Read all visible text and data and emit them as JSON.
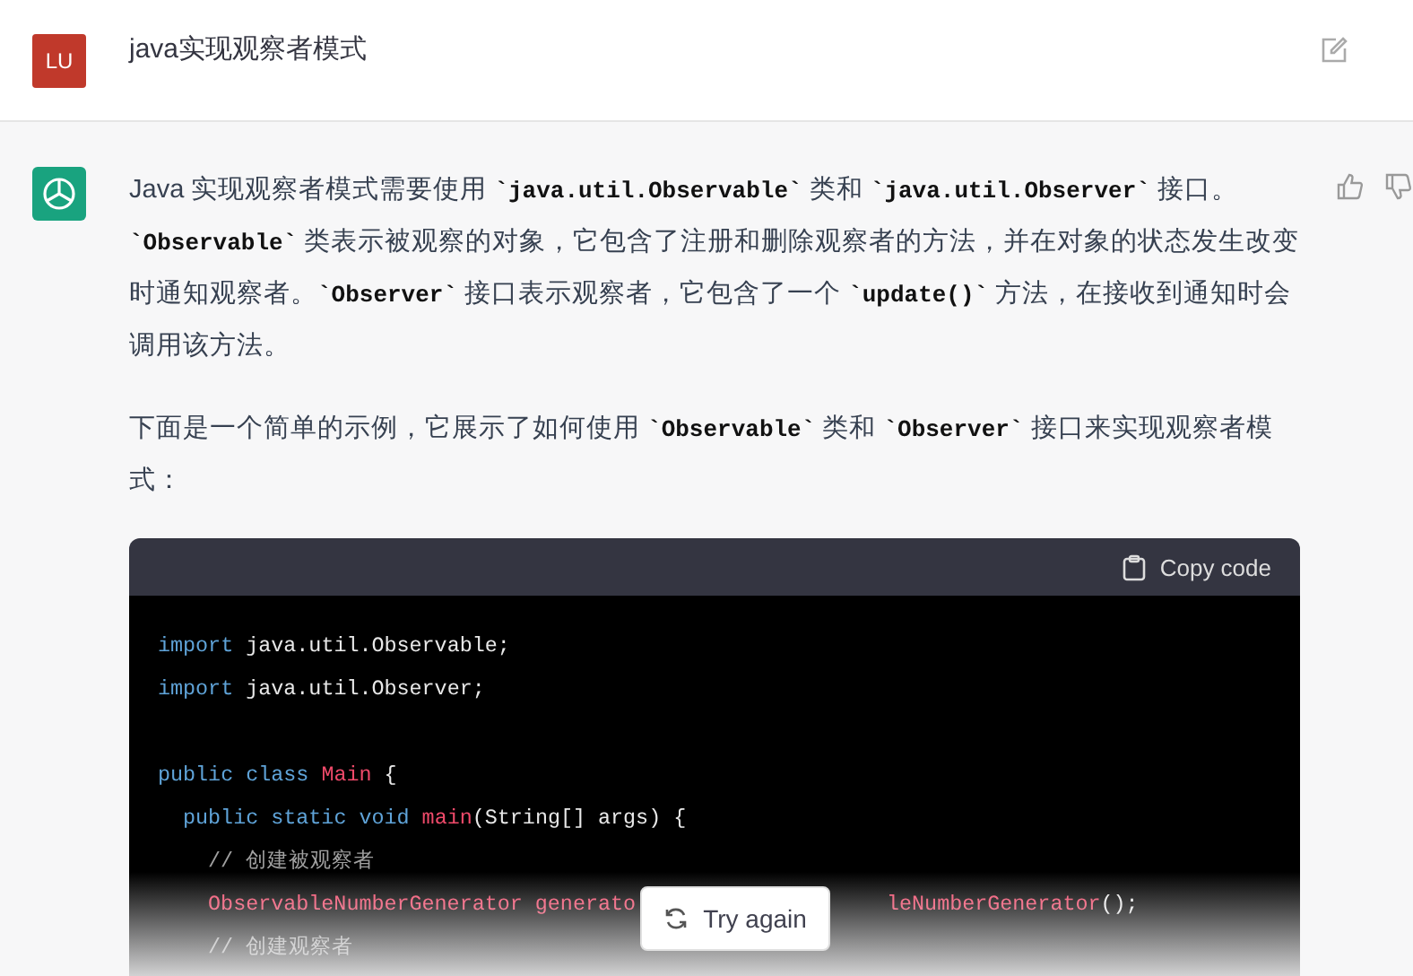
{
  "question": {
    "avatar": "LU",
    "text": "java实现观察者模式"
  },
  "answer": {
    "paragraphs": [
      "Java 实现观察者模式需要使用 **`java.util.Observable`** 类和 **`java.util.Observer`** 接口。**`Observable`** 类表示被观察的对象，它包含了注册和删除观察者的方法，并在对象的状态发生改变时通知观察者。**`Observer`** 接口表示观察者，它包含了一个 **`update()`** 方法，在接收到通知时会调用该方法。",
      "下面是一个简单的示例，它展示了如何使用 **`Observable`** 类和 **`Observer`** 接口来实现观察者模式："
    ],
    "code": {
      "copy_label": "Copy code",
      "lines": [
        {
          "tokens": [
            {
              "keyword": "import"
            },
            {
              "text": " java.util.Observable;"
            }
          ]
        },
        {
          "tokens": [
            {
              "keyword": "import"
            },
            {
              "text": " java.util.Observer;"
            }
          ]
        },
        {
          "blank_before": true,
          "tokens": [
            {
              "keyword": "public"
            },
            {
              "keyword": " class"
            },
            {
              "name": " Main"
            },
            {
              "text": " {"
            }
          ],
          "children": [
            {
              "tokens": [
                {
                  "keyword": "public"
                },
                {
                  "keyword": " static"
                },
                {
                  "keyword": " void"
                },
                {
                  "name": " main"
                },
                {
                  "text": "(String[] args) {"
                }
              ],
              "children": [
                {
                  "tokens": [
                    {
                      "comment": "// 创建被观察者"
                    }
                  ]
                },
                {
                  "tokens": [
                    {
                      "name": "ObservableNumberGenerator generato"
                    },
                    {
                      "covered": true
                    },
                    {
                      "name": "leNumberGenerator"
                    },
                    {
                      "text": "();"
                    }
                  ]
                },
                {
                  "tokens": [
                    {
                      "comment": "// 创建观察者"
                    }
                  ]
                }
              ]
            }
          ]
        }
      ]
    }
  },
  "try_again": "Try again"
}
